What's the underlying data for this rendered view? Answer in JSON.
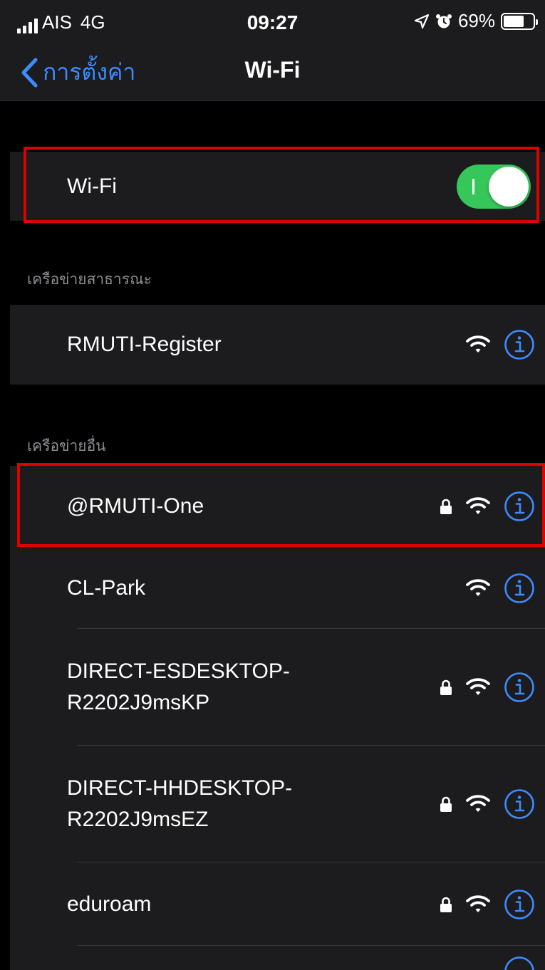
{
  "status_bar": {
    "carrier": "AIS",
    "network": "4G",
    "time": "09:27",
    "battery": "69%",
    "battery_level": 0.69
  },
  "nav": {
    "back_label": "การตั้งค่า",
    "title": "Wi-Fi"
  },
  "wifi_toggle": {
    "label": "Wi-Fi",
    "on": true
  },
  "public_section": {
    "header": "เครือข่ายสาธารณะ",
    "networks": [
      {
        "name": "RMUTI-Register",
        "locked": false
      }
    ]
  },
  "other_section": {
    "header": "เครือข่ายอื่น",
    "networks": [
      {
        "name": "@RMUTI-One",
        "locked": true
      },
      {
        "name": "CL-Park",
        "locked": false
      },
      {
        "name": "DIRECT-ESDESKTOP-\nR2202J9msKP",
        "locked": true
      },
      {
        "name": "DIRECT-HHDESKTOP-\nR2202J9msEZ",
        "locked": true
      },
      {
        "name": "eduroam",
        "locked": true
      }
    ]
  },
  "colors": {
    "accent": "#3d8bff",
    "toggle_on": "#35c759",
    "highlight": "#e00000",
    "background": "#000000",
    "cell": "#1c1c1e"
  }
}
